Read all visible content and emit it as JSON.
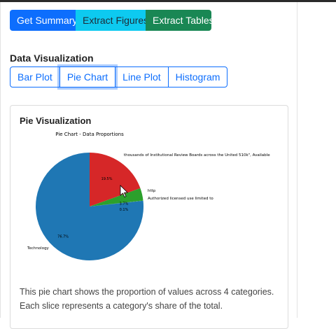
{
  "toolbar": {
    "summary_label": "Get Summary",
    "figures_label": "Extract Figures",
    "tables_label": "Extract Tables"
  },
  "visualization": {
    "heading": "Data Visualization",
    "tabs": [
      {
        "label": "Bar Plot",
        "active": false
      },
      {
        "label": "Pie Chart",
        "active": true
      },
      {
        "label": "Line Plot",
        "active": false
      },
      {
        "label": "Histogram",
        "active": false
      }
    ]
  },
  "card": {
    "title": "Pie Visualization",
    "description_line1": "This pie chart shows the proportion of values across 4 categories.",
    "description_line2": "Each slice represents a category's share of the total."
  },
  "chart_data": {
    "type": "pie",
    "title": "Pie Chart - Data Proportions",
    "slices": [
      {
        "label": "Technology",
        "value": 76.7,
        "pct_label": "76.7%",
        "color": "#1f77b4"
      },
      {
        "label": "thousands of Institutional Review Boards across the United 510k\", Available",
        "value": 19.5,
        "pct_label": "19.5%",
        "color": "#d62728"
      },
      {
        "label": "http",
        "value": 3.7,
        "pct_label": "3.7%",
        "color": "#2ca02c"
      },
      {
        "label": "Authorized licensed use limited to",
        "value": 0.1,
        "pct_label": "0.1%",
        "color": "#2ca02c"
      }
    ]
  },
  "colors": {
    "primary": "#0d6efd",
    "info": "#0dcaf0",
    "success": "#198754"
  }
}
